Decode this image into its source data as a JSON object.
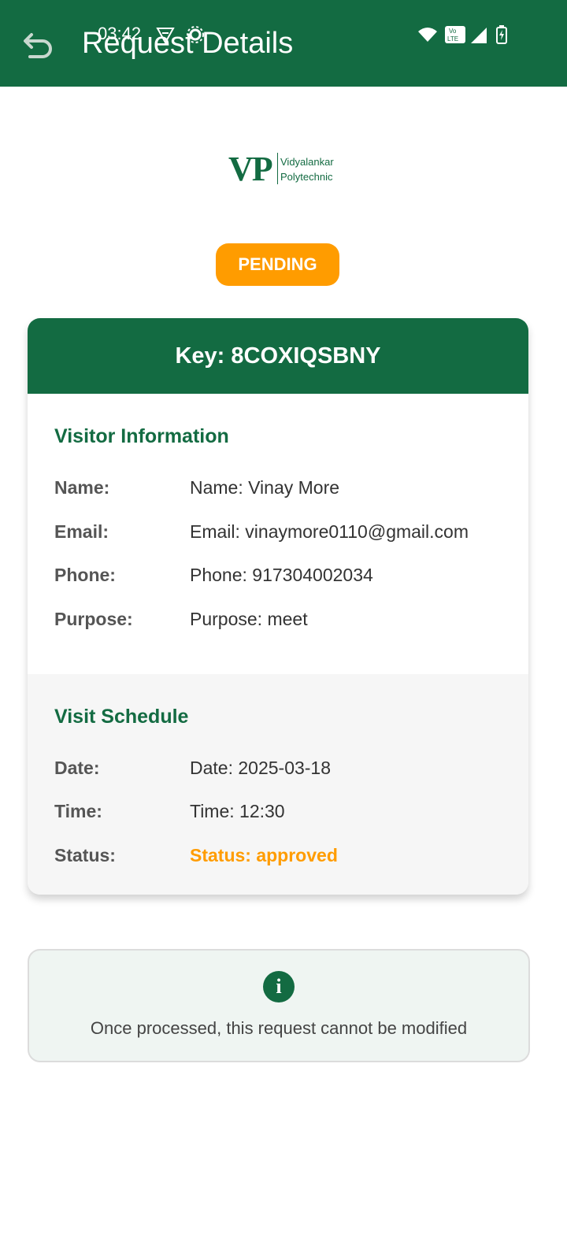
{
  "status_bar": {
    "time": "03:42"
  },
  "app_bar": {
    "title": "Request Details",
    "back_icon": "back-arrow-icon"
  },
  "logo": {
    "mark": "VP",
    "line1": "Vidyalankar",
    "line2": "Polytechnic"
  },
  "badge": {
    "label": "PENDING"
  },
  "card": {
    "key": "Key: 8COXIQSBNY",
    "visitor": {
      "title": "Visitor Information",
      "rows": [
        {
          "label": "Name:",
          "value": "Name: Vinay More"
        },
        {
          "label": "Email:",
          "value": "Email: vinaymore0110@gmail.com"
        },
        {
          "label": "Phone:",
          "value": "Phone: 917304002034"
        },
        {
          "label": "Purpose:",
          "value": "Purpose: meet"
        }
      ]
    },
    "schedule": {
      "title": "Visit Schedule",
      "rows": [
        {
          "label": "Date:",
          "value": "Date: 2025-03-18"
        },
        {
          "label": "Time:",
          "value": "Time: 12:30"
        },
        {
          "label": "Status:",
          "value": "Status: approved"
        }
      ]
    }
  },
  "notice": {
    "icon": "info-icon",
    "text": "Once processed, this request cannot be modified"
  },
  "colors": {
    "primary": "#136b42",
    "accent": "#ff9c00"
  }
}
